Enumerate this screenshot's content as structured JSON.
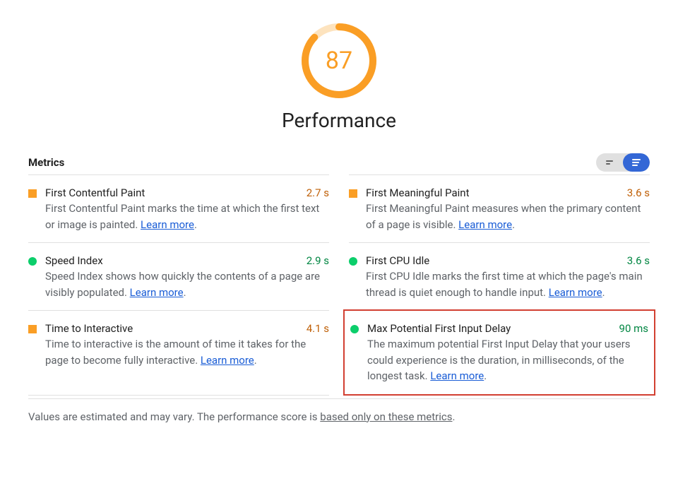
{
  "gauge": {
    "score": "87",
    "title": "Performance",
    "percent": 87,
    "color": "#fa9e25"
  },
  "metricsHeading": "Metrics",
  "learnMore": "Learn more",
  "metrics": [
    {
      "title": "First Contentful Paint",
      "value": "2.7 s",
      "status": "avg",
      "desc": "First Contentful Paint marks the time at which the first text or image is painted. "
    },
    {
      "title": "First Meaningful Paint",
      "value": "3.6 s",
      "status": "avg",
      "desc": "First Meaningful Paint measures when the primary content of a page is visible. "
    },
    {
      "title": "Speed Index",
      "value": "2.9 s",
      "status": "good",
      "desc": "Speed Index shows how quickly the contents of a page are visibly populated. "
    },
    {
      "title": "First CPU Idle",
      "value": "3.6 s",
      "status": "good",
      "desc": "First CPU Idle marks the first time at which the page's main thread is quiet enough to handle input. "
    },
    {
      "title": "Time to Interactive",
      "value": "4.1 s",
      "status": "avg",
      "desc": "Time to interactive is the amount of time it takes for the page to become fully interactive. "
    },
    {
      "title": "Max Potential First Input Delay",
      "value": "90 ms",
      "status": "good",
      "desc": "The maximum potential First Input Delay that your users could experience is the duration, in milliseconds, of the longest task. ",
      "highlight": true
    }
  ],
  "footer": {
    "prefix": "Values are estimated and may vary. The performance score is ",
    "link": "based only on these metrics",
    "suffix": "."
  }
}
